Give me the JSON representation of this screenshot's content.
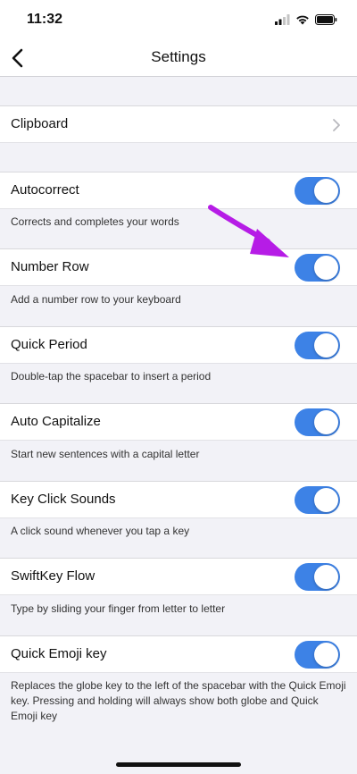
{
  "status_bar": {
    "time": "11:32"
  },
  "nav": {
    "title": "Settings"
  },
  "clipboard": {
    "label": "Clipboard"
  },
  "settings": [
    {
      "label": "Autocorrect",
      "description": "Corrects and completes your words",
      "enabled": true
    },
    {
      "label": "Number Row",
      "description": "Add a number row to your keyboard",
      "enabled": true
    },
    {
      "label": "Quick Period",
      "description": "Double-tap the spacebar to insert a period",
      "enabled": true
    },
    {
      "label": "Auto Capitalize",
      "description": "Start new sentences with a capital letter",
      "enabled": true
    },
    {
      "label": "Key Click Sounds",
      "description": "A click sound whenever you tap a key",
      "enabled": true
    },
    {
      "label": "SwiftKey Flow",
      "description": "Type by sliding your finger from letter to letter",
      "enabled": true
    },
    {
      "label": "Quick Emoji key",
      "description": "Replaces the globe key to the left of the spacebar with the Quick Emoji key. Pressing and holding will always show both globe and Quick Emoji key",
      "enabled": true
    }
  ],
  "colors": {
    "toggle_on": "#3d82e6",
    "annotation_arrow": "#b61ce6"
  }
}
